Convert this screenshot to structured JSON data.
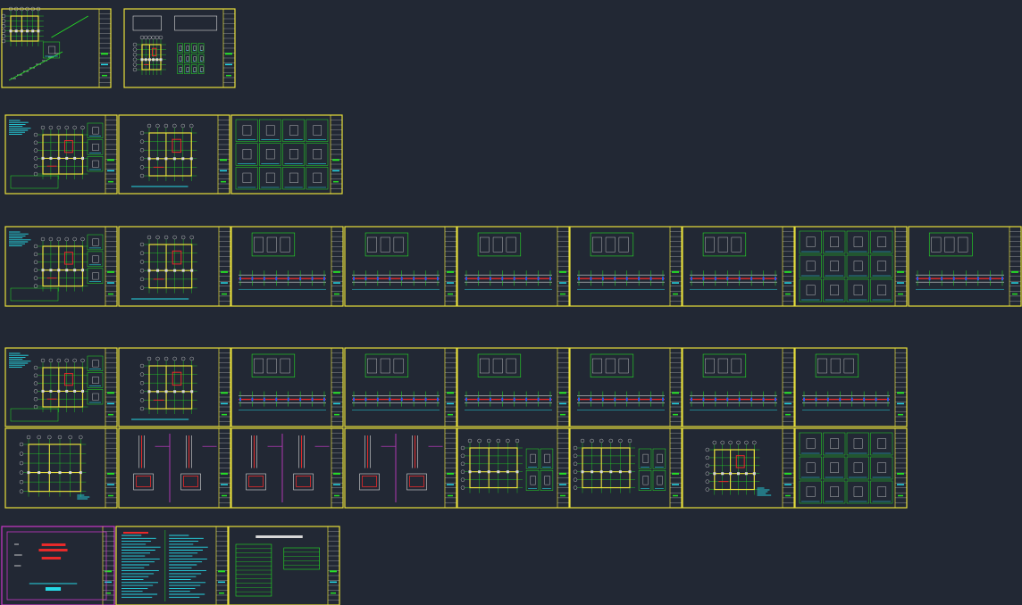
{
  "viewport": {
    "background": "#222834"
  },
  "colors": {
    "frame_yellow": "#e8e03a",
    "frame_magenta": "#c837c8",
    "linework_green": "#25e025",
    "linework_cyan": "#26d9e6",
    "highlight_red": "#e82a2a",
    "dimension_blue": "#2a5ce8",
    "magenta_lines": "#d23cd2",
    "white_lines": "#d8d8d8"
  },
  "sheet_groups": [
    {
      "name": "row-1",
      "kinds": [
        "stair-details",
        "tank-details"
      ]
    },
    {
      "name": "row-2",
      "kinds": [
        "plan-with-notes",
        "plan",
        "detail-grid"
      ]
    },
    {
      "name": "row-3",
      "kinds": [
        "plan-with-notes",
        "plan",
        "beam-elevation",
        "beam-elevation",
        "beam-elevation",
        "beam-elevation",
        "beam-elevation",
        "detail-grid",
        "beam-elevation"
      ]
    },
    {
      "name": "row-4",
      "kinds": [
        "plan-with-notes",
        "plan",
        "beam-elevation",
        "beam-elevation",
        "beam-elevation",
        "beam-elevation",
        "beam-elevation",
        "beam-elevation"
      ]
    },
    {
      "name": "row-5",
      "kinds": [
        "foundation-plan",
        "column-details",
        "column-details",
        "column-details",
        "frame-plan",
        "frame-plan",
        "slab-plan",
        "detail-grid"
      ]
    },
    {
      "name": "row-6",
      "kinds": [
        "cover-sheet",
        "general-notes",
        "drawing-index"
      ]
    }
  ]
}
